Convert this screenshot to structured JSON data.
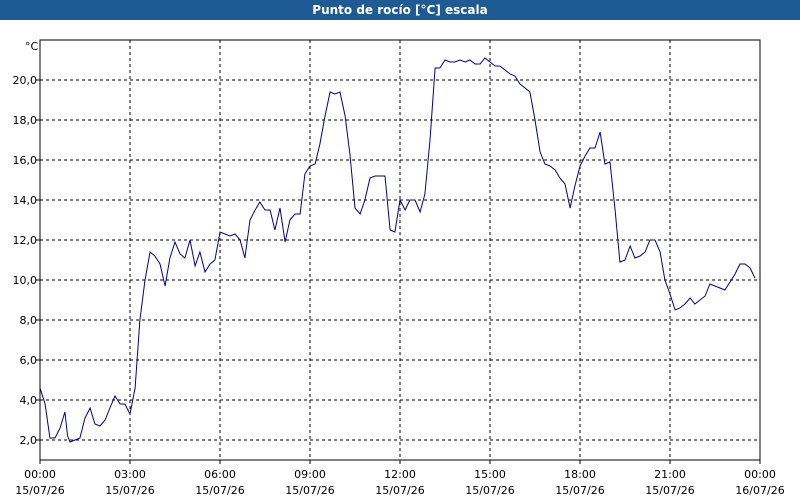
{
  "chart_data": {
    "type": "line",
    "title": "Punto de rocío [°C] escala",
    "ylabel": "°C",
    "xlabel": "",
    "xlim": [
      0,
      24
    ],
    "ylim": [
      1.0,
      22.0
    ],
    "grid": true,
    "yticks": [
      2,
      4,
      6,
      8,
      10,
      12,
      14,
      16,
      18,
      20
    ],
    "ytick_labels": [
      "2,0",
      "4,0",
      "6,0",
      "8,0",
      "10,0",
      "12,0",
      "14,0",
      "16,0",
      "18,0",
      "20,0"
    ],
    "xticks": [
      {
        "x": 0,
        "time": "00:00",
        "date": "15/07/26"
      },
      {
        "x": 3,
        "time": "03:00",
        "date": "15/07/26"
      },
      {
        "x": 6,
        "time": "06:00",
        "date": "15/07/26"
      },
      {
        "x": 9,
        "time": "09:00",
        "date": "15/07/26"
      },
      {
        "x": 12,
        "time": "12:00",
        "date": "15/07/26"
      },
      {
        "x": 15,
        "time": "15:00",
        "date": "15/07/26"
      },
      {
        "x": 18,
        "time": "18:00",
        "date": "15/07/26"
      },
      {
        "x": 21,
        "time": "21:00",
        "date": "15/07/26"
      },
      {
        "x": 24,
        "time": "00:00",
        "date": "16/07/26"
      }
    ],
    "line_color": "#00008b",
    "series": [
      {
        "values": [
          [
            0.0,
            4.6
          ],
          [
            0.17,
            3.8
          ],
          [
            0.33,
            2.1
          ],
          [
            0.5,
            2.1
          ],
          [
            0.67,
            2.6
          ],
          [
            0.83,
            3.4
          ],
          [
            0.92,
            2.2
          ],
          [
            1.0,
            1.9
          ],
          [
            1.17,
            2.0
          ],
          [
            1.33,
            2.1
          ],
          [
            1.5,
            3.1
          ],
          [
            1.67,
            3.6
          ],
          [
            1.83,
            2.8
          ],
          [
            2.0,
            2.7
          ],
          [
            2.17,
            3.0
          ],
          [
            2.33,
            3.6
          ],
          [
            2.5,
            4.2
          ],
          [
            2.67,
            3.8
          ],
          [
            2.83,
            3.8
          ],
          [
            3.0,
            3.3
          ],
          [
            3.17,
            4.6
          ],
          [
            3.33,
            8.0
          ],
          [
            3.5,
            10.0
          ],
          [
            3.67,
            11.4
          ],
          [
            3.83,
            11.2
          ],
          [
            4.0,
            10.8
          ],
          [
            4.17,
            9.7
          ],
          [
            4.33,
            11.1
          ],
          [
            4.5,
            11.9
          ],
          [
            4.67,
            11.3
          ],
          [
            4.83,
            11.1
          ],
          [
            5.0,
            12.0
          ],
          [
            5.17,
            10.7
          ],
          [
            5.33,
            11.4
          ],
          [
            5.5,
            10.4
          ],
          [
            5.67,
            10.8
          ],
          [
            5.83,
            11.0
          ],
          [
            6.0,
            12.4
          ],
          [
            6.17,
            12.3
          ],
          [
            6.33,
            12.2
          ],
          [
            6.5,
            12.3
          ],
          [
            6.67,
            12.0
          ],
          [
            6.83,
            11.1
          ],
          [
            7.0,
            13.0
          ],
          [
            7.17,
            13.5
          ],
          [
            7.33,
            13.9
          ],
          [
            7.5,
            13.5
          ],
          [
            7.67,
            13.5
          ],
          [
            7.83,
            12.5
          ],
          [
            8.0,
            13.6
          ],
          [
            8.17,
            11.9
          ],
          [
            8.33,
            13.0
          ],
          [
            8.5,
            13.3
          ],
          [
            8.67,
            13.3
          ],
          [
            8.83,
            15.3
          ],
          [
            9.0,
            15.7
          ],
          [
            9.17,
            15.8
          ],
          [
            9.33,
            16.8
          ],
          [
            9.5,
            18.2
          ],
          [
            9.67,
            19.4
          ],
          [
            9.83,
            19.3
          ],
          [
            10.0,
            19.4
          ],
          [
            10.17,
            18.2
          ],
          [
            10.33,
            16.3
          ],
          [
            10.5,
            13.6
          ],
          [
            10.67,
            13.3
          ],
          [
            10.83,
            14.0
          ],
          [
            11.0,
            15.1
          ],
          [
            11.17,
            15.2
          ],
          [
            11.33,
            15.2
          ],
          [
            11.5,
            15.2
          ],
          [
            11.67,
            12.5
          ],
          [
            11.83,
            12.4
          ],
          [
            12.0,
            14.0
          ],
          [
            12.17,
            13.5
          ],
          [
            12.33,
            14.0
          ],
          [
            12.5,
            14.0
          ],
          [
            12.67,
            13.4
          ],
          [
            12.83,
            14.3
          ],
          [
            13.0,
            17.0
          ],
          [
            13.17,
            20.6
          ],
          [
            13.33,
            20.6
          ],
          [
            13.5,
            21.0
          ],
          [
            13.67,
            20.9
          ],
          [
            13.83,
            20.9
          ],
          [
            14.0,
            21.0
          ],
          [
            14.17,
            20.9
          ],
          [
            14.33,
            21.0
          ],
          [
            14.5,
            20.8
          ],
          [
            14.67,
            20.8
          ],
          [
            14.83,
            21.1
          ],
          [
            15.0,
            20.9
          ],
          [
            15.17,
            20.7
          ],
          [
            15.33,
            20.7
          ],
          [
            15.5,
            20.5
          ],
          [
            15.67,
            20.3
          ],
          [
            15.83,
            20.2
          ],
          [
            16.0,
            19.8
          ],
          [
            16.17,
            19.6
          ],
          [
            16.33,
            19.4
          ],
          [
            16.5,
            18.0
          ],
          [
            16.67,
            16.4
          ],
          [
            16.83,
            15.8
          ],
          [
            17.0,
            15.7
          ],
          [
            17.17,
            15.5
          ],
          [
            17.33,
            15.1
          ],
          [
            17.5,
            14.8
          ],
          [
            17.67,
            13.6
          ],
          [
            17.83,
            14.7
          ],
          [
            18.0,
            15.7
          ],
          [
            18.17,
            16.2
          ],
          [
            18.33,
            16.6
          ],
          [
            18.5,
            16.6
          ],
          [
            18.67,
            17.4
          ],
          [
            18.83,
            15.8
          ],
          [
            19.0,
            15.9
          ],
          [
            19.17,
            13.5
          ],
          [
            19.33,
            10.9
          ],
          [
            19.5,
            11.0
          ],
          [
            19.67,
            11.7
          ],
          [
            19.83,
            11.1
          ],
          [
            20.0,
            11.2
          ],
          [
            20.17,
            11.4
          ],
          [
            20.33,
            12.0
          ],
          [
            20.5,
            12.0
          ],
          [
            20.67,
            11.4
          ],
          [
            20.83,
            10.0
          ],
          [
            21.0,
            9.3
          ],
          [
            21.17,
            8.5
          ],
          [
            21.33,
            8.6
          ],
          [
            21.5,
            8.8
          ],
          [
            21.67,
            9.1
          ],
          [
            21.83,
            8.8
          ],
          [
            22.0,
            9.0
          ],
          [
            22.17,
            9.2
          ],
          [
            22.33,
            9.8
          ],
          [
            22.5,
            9.7
          ],
          [
            22.67,
            9.6
          ],
          [
            22.83,
            9.5
          ],
          [
            23.0,
            9.9
          ],
          [
            23.17,
            10.3
          ],
          [
            23.33,
            10.8
          ],
          [
            23.5,
            10.8
          ],
          [
            23.67,
            10.6
          ],
          [
            23.83,
            10.1
          ]
        ]
      }
    ]
  }
}
